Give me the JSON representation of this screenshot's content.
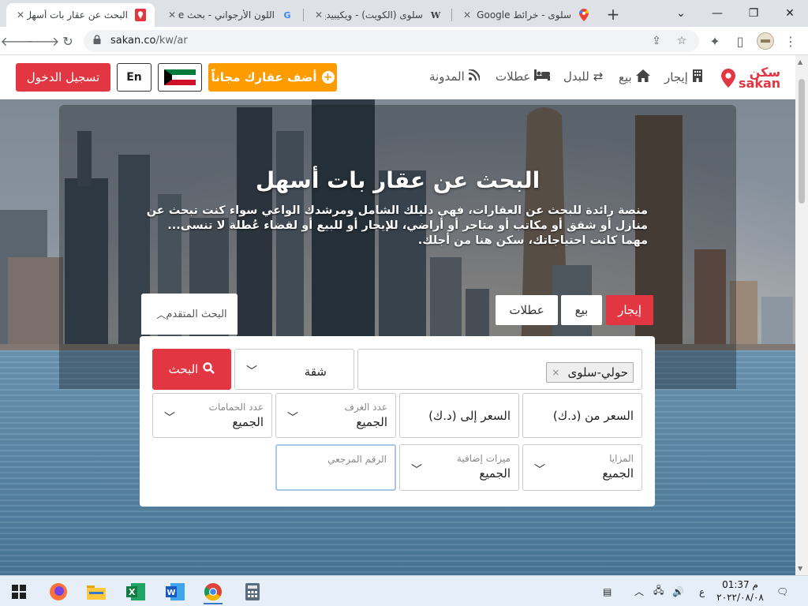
{
  "browser": {
    "tabs": [
      {
        "title": "البحث عن عقار بات أسهل",
        "active": true,
        "favicon": "sakan-pin-icon"
      },
      {
        "title": "اللون الأرجواني - بحث Google",
        "active": false,
        "favicon": "google-icon"
      },
      {
        "title": "سلوى (الكويت) - ويكيبيديا",
        "active": false,
        "favicon": "wikipedia-icon"
      },
      {
        "title": "سلوى - خرائط Google",
        "active": false,
        "favicon": "google-maps-icon"
      }
    ],
    "url_host": "sakan.co",
    "url_path": "/kw/ar",
    "new_tab_symbol": "+"
  },
  "header": {
    "logo_ar": "سكن",
    "logo_en": "sakan",
    "nav": [
      {
        "label": "إيجار",
        "icon": "building-icon"
      },
      {
        "label": "بيع",
        "icon": "home-icon"
      },
      {
        "label": "للبدل",
        "icon": "exchange-icon"
      },
      {
        "label": "عطلات",
        "icon": "bed-icon"
      },
      {
        "label": "المدونة",
        "icon": "rss-icon"
      }
    ],
    "add_property_label": "أضف عقارك مجاناً",
    "language_label": "En",
    "login_label": "تسجيل الدخول",
    "colors": {
      "brand_red": "#e23742",
      "accent_orange": "#fd9c00"
    }
  },
  "hero": {
    "title": "البحث عن عقار بات أسهل",
    "description": "منصة رائدة للبحث عن العقارات، فهي دليلك الشامل ومرشدك الواعي سواء كنت تبحث عن منازل أو شقق أو مكاتب أو متاجر أو أراضي، للإيجار أو للبيع أو لقضاء عُطلة لا تنسى... مهما كانت احتياجاتك، سكن هنا من أجلك."
  },
  "search": {
    "tabs": {
      "rent": "إيجار",
      "sale": "بيع",
      "holidays": "عطلات"
    },
    "advanced_label": "البحث المتقدم",
    "location_chip": "حولي-سلوى",
    "property_type": "شقة",
    "search_button": "البحث",
    "price_from": "السعر من (د.ك)",
    "price_to": "السعر إلى (د.ك)",
    "rooms": {
      "label": "عدد الغرف",
      "value": "الجميع"
    },
    "baths": {
      "label": "عدد الحمامات",
      "value": "الجميع"
    },
    "features": {
      "label": "المزايا",
      "value": "الجميع"
    },
    "extras": {
      "label": "ميزات إضافية",
      "value": "الجميع"
    },
    "reference": {
      "placeholder": "الرقم المرجعي"
    }
  },
  "taskbar": {
    "apps": [
      "windows-start-icon",
      "firefox-icon",
      "file-explorer-icon",
      "excel-icon",
      "word-icon",
      "chrome-icon",
      "calculator-icon"
    ],
    "time": "01:37 م",
    "date": "٢٠٢٢/٠٨/٠٨",
    "input_lang": "ع"
  }
}
